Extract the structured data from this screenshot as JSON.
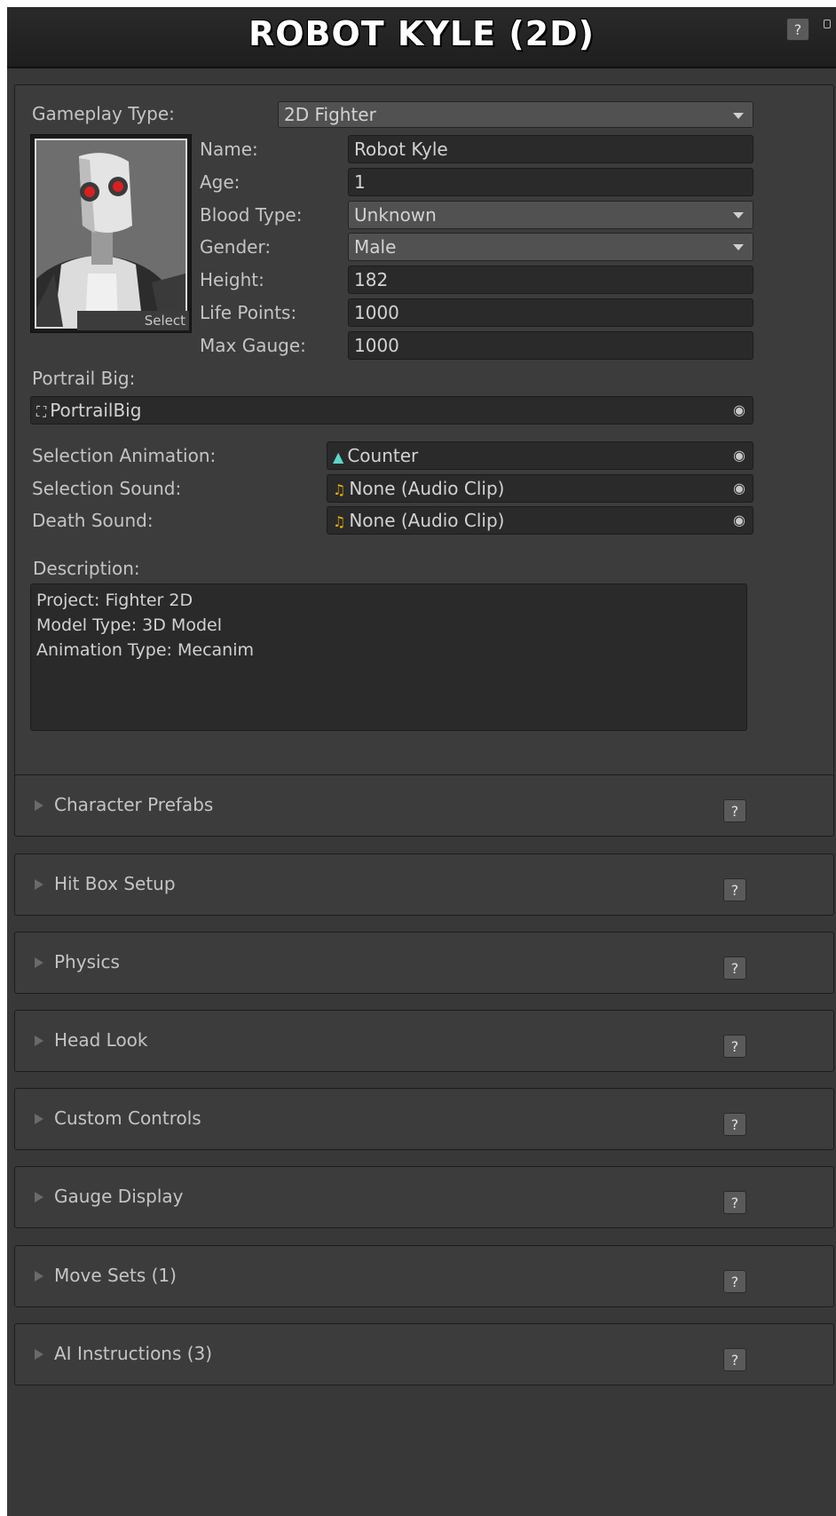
{
  "header": {
    "title": "ROBOT KYLE (2D)",
    "help_label": "?"
  },
  "general": {
    "gameplay_type_label": "Gameplay Type:",
    "gameplay_type_value": "2D Fighter",
    "name_label": "Name:",
    "name_value": "Robot Kyle",
    "age_label": "Age:",
    "age_value": "1",
    "blood_type_label": "Blood Type:",
    "blood_type_value": "Unknown",
    "gender_label": "Gender:",
    "gender_value": "Male",
    "height_label": "Height:",
    "height_value": "182",
    "life_points_label": "Life Points:",
    "life_points_value": "1000",
    "max_gauge_label": "Max Gauge:",
    "max_gauge_value": "1000",
    "portrait_select_label": "Select",
    "portrait_big_label": "Portrail Big:",
    "portrait_big_value": "PortrailBig",
    "selection_animation_label": "Selection Animation:",
    "selection_animation_value": "Counter",
    "selection_sound_label": "Selection Sound:",
    "selection_sound_value": "None (Audio Clip)",
    "death_sound_label": "Death Sound:",
    "death_sound_value": "None (Audio Clip)",
    "description_label": "Description:",
    "description_lines": [
      "Project: Fighter 2D",
      "Model Type: 3D Model",
      "Animation Type: Mecanim"
    ]
  },
  "sections": [
    {
      "label": "Character Prefabs"
    },
    {
      "label": "Hit Box Setup"
    },
    {
      "label": "Physics"
    },
    {
      "label": "Head Look"
    },
    {
      "label": "Custom Controls"
    },
    {
      "label": "Gauge Display"
    },
    {
      "label": "Move Sets (1)"
    },
    {
      "label": "AI Instructions (3)"
    }
  ],
  "icons": {
    "portrait_icon": "image-icon",
    "animation_icon": "animation-clip-icon",
    "audio_icon": "audio-clip-icon",
    "object_picker": "object-picker-icon",
    "foldout": "foldout-arrow-icon"
  },
  "colors": {
    "background": "#383838",
    "field": "#2a2a2a",
    "animation_icon": "#5cd6c8",
    "audio_icon": "#f0b400"
  }
}
